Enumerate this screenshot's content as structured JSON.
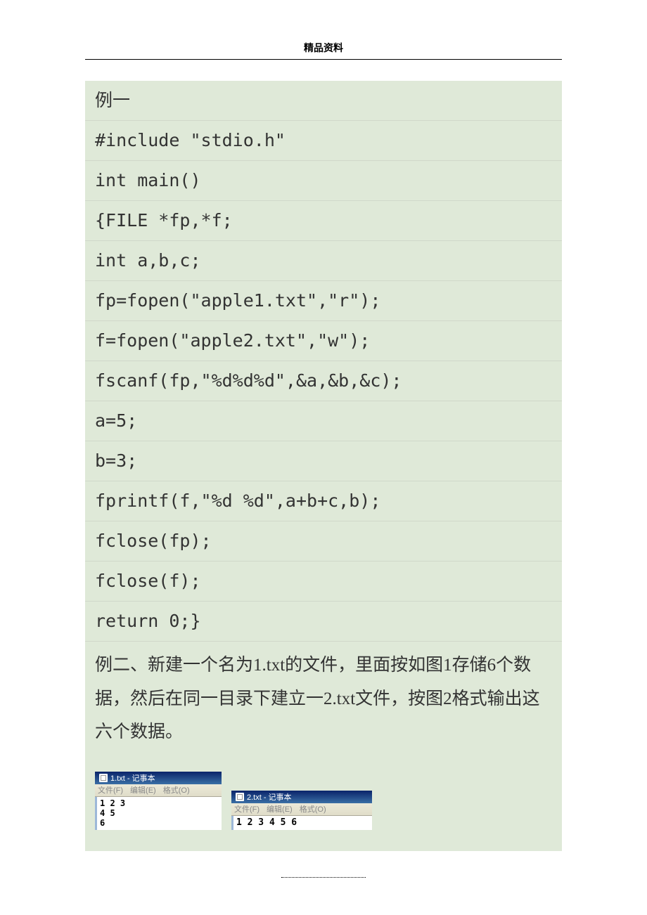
{
  "header": "精品资料",
  "code": {
    "line1": "例一",
    "line2": "#include \"stdio.h\"",
    "line3": " int main()",
    "line4": "{FILE *fp,*f;",
    "line5": "      int a,b,c;",
    "line6": "      fp=fopen(\"apple1.txt\",\"r\");",
    "line7": "      f=fopen(\"apple2.txt\",\"w\");",
    "line8": "      fscanf(fp,\"%d%d%d\",&a,&b,&c);",
    "line9": "      a=5;",
    "line10": "      b=3;",
    "line11": "      fprintf(f,\"%d  %d\",a+b+c,b);",
    "line12": "      fclose(fp);",
    "line13": "      fclose(f);",
    "line14": "      return 0;}"
  },
  "example2_text": " 例二、新建一个名为1.txt的文件，里面按如图1存储6个数据，然后在同一目录下建立一2.txt文件，按图2格式输出这六个数据。",
  "notepad1": {
    "title": "1.txt - 记事本",
    "menu": {
      "file": "文件(F)",
      "edit": "编辑(E)",
      "format": "格式(O)"
    },
    "content": "1 2 3\n4 5\n6"
  },
  "notepad2": {
    "title": "2.txt - 记事本",
    "menu": {
      "file": "文件(F)",
      "edit": "编辑(E)",
      "format": "格式(O)"
    },
    "content": "1 2 3 4 5 6"
  }
}
